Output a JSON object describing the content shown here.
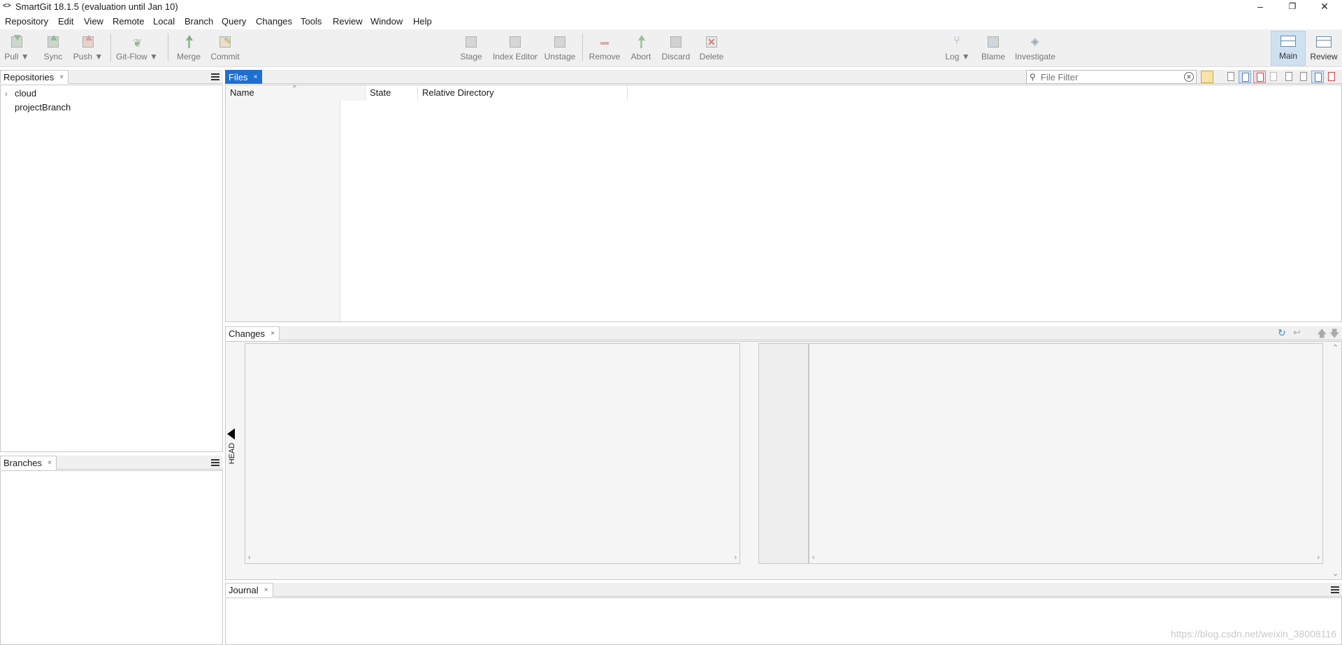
{
  "window": {
    "title": "SmartGit 18.1.5 (evaluation until Jan 10)",
    "app_icon": "<>",
    "minimize_glyph": "–",
    "restore_glyph": "❐",
    "close_glyph": "✕"
  },
  "menu": [
    "Repository",
    "Edit",
    "View",
    "Remote",
    "Local",
    "Branch",
    "Query",
    "Changes",
    "Tools",
    "Review",
    "Window",
    "Help"
  ],
  "toolbar": {
    "pull": "Pull ▼",
    "sync": "Sync",
    "push": "Push ▼",
    "gitflow": "Git-Flow ▼",
    "merge": "Merge",
    "commit": "Commit",
    "stage": "Stage",
    "index_editor": "Index Editor",
    "unstage": "Unstage",
    "remove": "Remove",
    "abort": "Abort",
    "discard": "Discard",
    "delete": "Delete",
    "log": "Log ▼",
    "blame": "Blame",
    "investigate": "Investigate",
    "main": "Main",
    "review": "Review"
  },
  "repositories": {
    "tab": "Repositories",
    "items": [
      {
        "label": "cloud",
        "expander": "›"
      },
      {
        "label": "projectBranch",
        "expander": ""
      }
    ]
  },
  "branches": {
    "tab": "Branches"
  },
  "files": {
    "tab": "Files",
    "columns": [
      "Name",
      "State",
      "Relative Directory"
    ],
    "sort_indicator": "^",
    "filter_placeholder": "File Filter"
  },
  "changes": {
    "tab": "Changes",
    "head_label": "HEAD"
  },
  "journal": {
    "tab": "Journal"
  },
  "tab_close": "×",
  "watermark": "https://blog.csdn.net/weixin_38008116",
  "colors": {
    "selected_tab": "#1e6fd0",
    "active_perspective": "#cfe0f1"
  }
}
